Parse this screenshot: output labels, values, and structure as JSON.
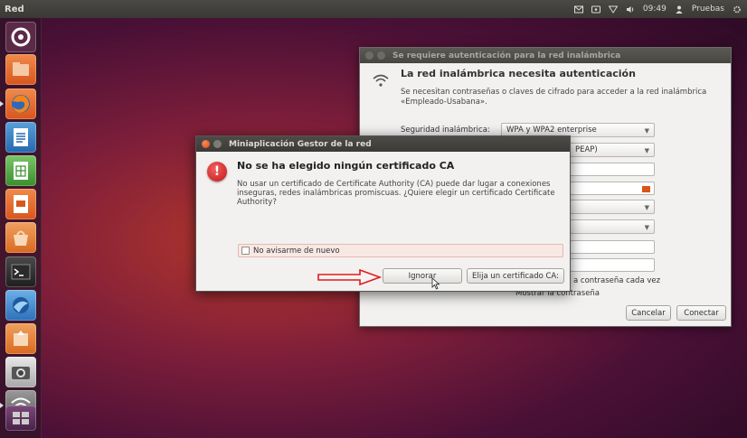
{
  "top_panel": {
    "app_name": "Red",
    "clock": "09:49",
    "user": "Pruebas",
    "icons": [
      "mail-icon",
      "keyboard-icon",
      "wifi-icon",
      "volume-icon",
      "user-icon",
      "gear-icon"
    ]
  },
  "launcher": {
    "items": [
      "dash-icon",
      "files-icon",
      "firefox-icon",
      "writer-icon",
      "calc-icon",
      "impress-icon",
      "software-center-icon",
      "terminal-icon",
      "thunderbird-icon",
      "update-manager-icon",
      "screenshot-icon",
      "network-icon",
      "workspaces-icon"
    ]
  },
  "wifi_dialog": {
    "title": "Se requiere autenticación para la red inalámbrica",
    "heading": "La red inalámbrica necesita autenticación",
    "description": "Se necesitan contraseñas o claves de cifrado para acceder a la red inalámbrica «Empleado-Usabana».",
    "security_label": "Seguridad inalámbrica:",
    "security_value": "WPA y WPA2 enterprise",
    "auth_value": "PEAP)",
    "ask_password_text": "a contraseña cada vez",
    "show_password_text": "Mostrar la contraseña",
    "cancel_label": "Cancelar",
    "connect_label": "Conectar"
  },
  "alert_dialog": {
    "title": "Miniaplicación Gestor de la red",
    "heading": "No se ha elegido ningún certificado CA",
    "description": "No usar un certificado de Certificate Authority (CA) puede dar lugar a conexiones inseguras, redes inalámbricas promiscuas. ¿Quiere elegir un certificado Certificate Authority?",
    "checkbox_label": "No avisarme de nuevo",
    "ignore_label": "Ignorar",
    "choose_label": "Elija un certificado CA:"
  },
  "colors": {
    "accent_orange": "#dd4814",
    "alert_red": "#c41616",
    "panel_dark": "#3c3b37"
  }
}
